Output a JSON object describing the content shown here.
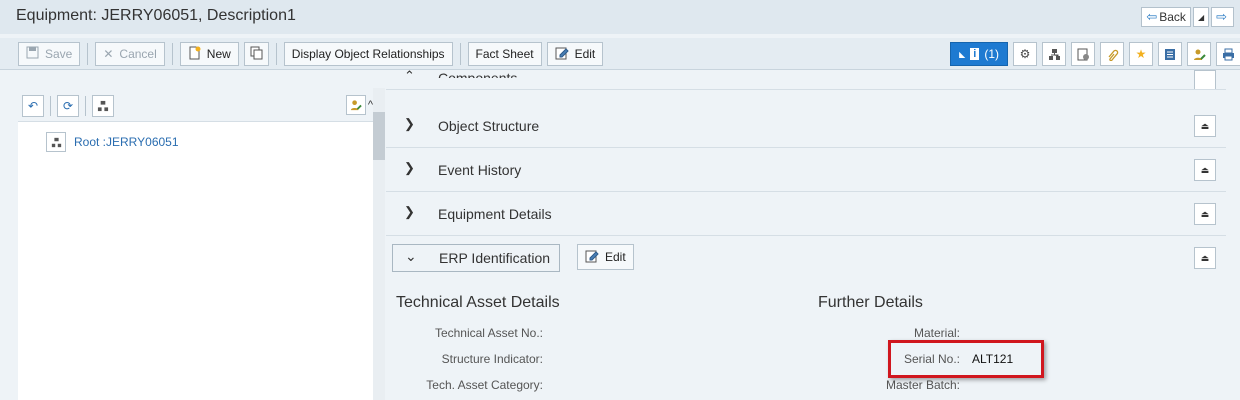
{
  "window": {
    "title": "Equipment: JERRY06051, Description1",
    "back_label": "Back"
  },
  "toolbar": {
    "save": "Save",
    "cancel": "Cancel",
    "new": "New",
    "display_relationships": "Display Object Relationships",
    "fact_sheet": "Fact Sheet",
    "edit": "Edit",
    "messages": "(1)"
  },
  "tree": {
    "root_label": "Root :JERRY06051"
  },
  "sections": {
    "components": "Components",
    "object_structure": "Object Structure",
    "event_history": "Event History",
    "equipment_details": "Equipment Details",
    "erp_identification": "ERP Identification",
    "erp_edit": "Edit"
  },
  "technical_asset_details": {
    "heading": "Technical Asset Details",
    "fields": [
      {
        "label": "Technical Asset No.:",
        "value": ""
      },
      {
        "label": "Structure Indicator:",
        "value": ""
      },
      {
        "label": "Tech. Asset Category:",
        "value": ""
      }
    ]
  },
  "further_details": {
    "heading": "Further Details",
    "fields": [
      {
        "label": "Material:",
        "value": ""
      },
      {
        "label": "Serial No.:",
        "value": "ALT121"
      },
      {
        "label": "Master Batch:",
        "value": ""
      }
    ]
  },
  "colors": {
    "accent": "#1e7ad1",
    "highlight": "#d0161e",
    "link": "#2a6db0"
  }
}
